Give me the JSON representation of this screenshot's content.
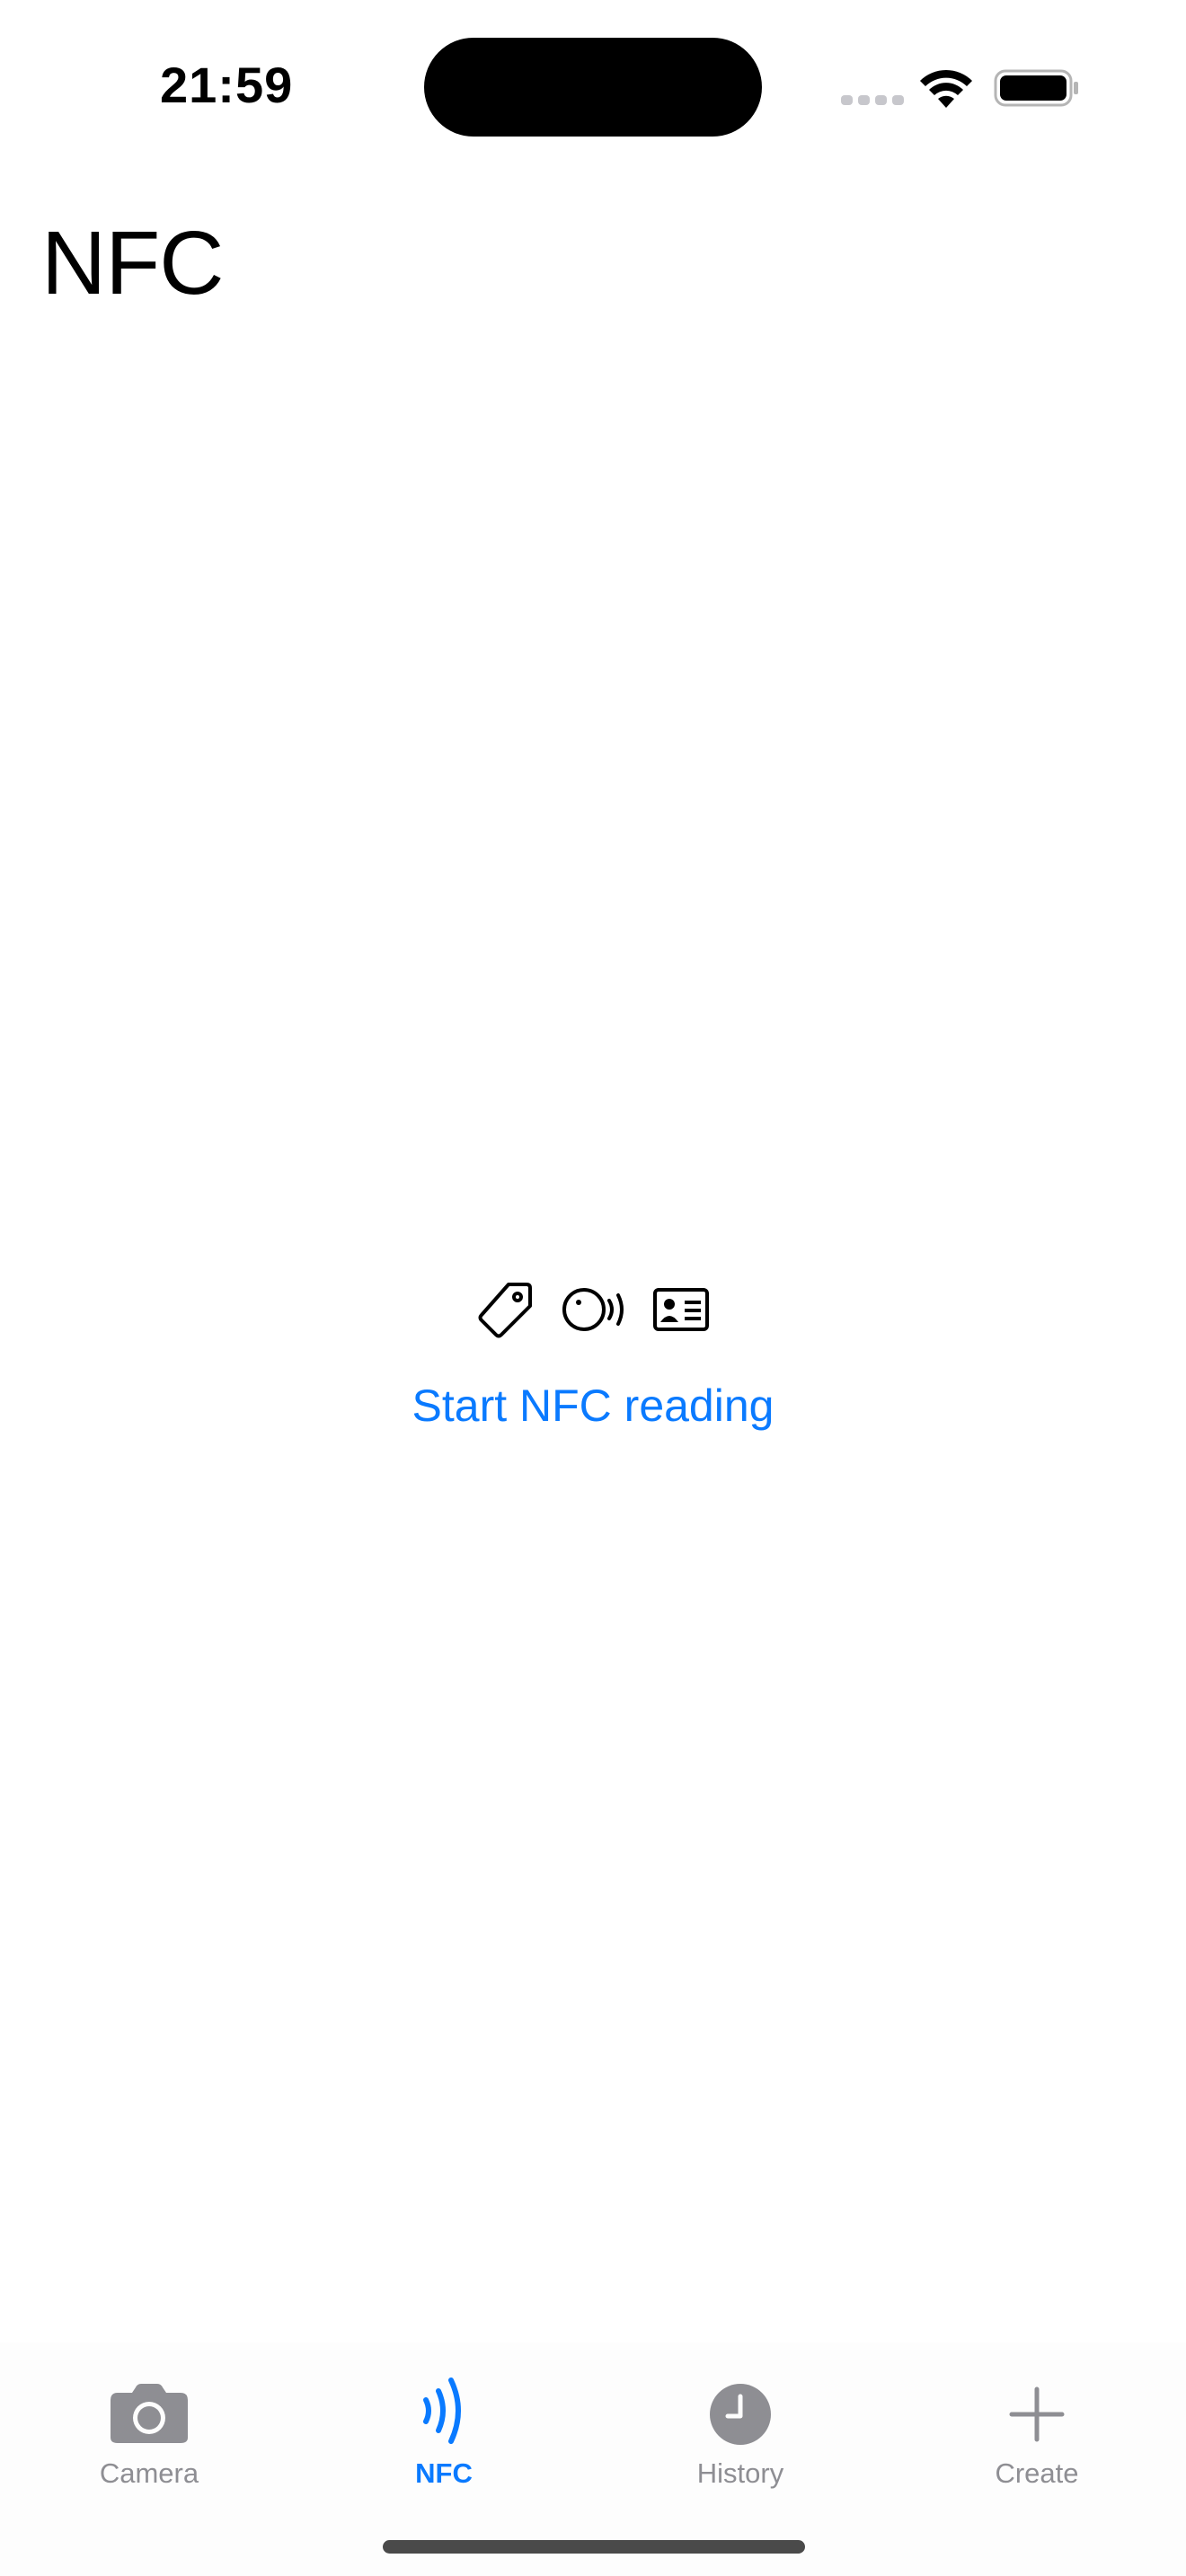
{
  "status_bar": {
    "time": "21:59"
  },
  "page": {
    "title": "NFC"
  },
  "main": {
    "icons": [
      "tag-icon",
      "nfc-reader-icon",
      "id-card-icon"
    ],
    "start_button_label": "Start NFC reading"
  },
  "tab_bar": {
    "tabs": [
      {
        "label": "Camera",
        "icon": "camera-icon",
        "active": false
      },
      {
        "label": "NFC",
        "icon": "nfc-icon",
        "active": true
      },
      {
        "label": "History",
        "icon": "clock-icon",
        "active": false
      },
      {
        "label": "Create",
        "icon": "plus-icon",
        "active": false
      }
    ]
  },
  "colors": {
    "accent": "#0a7aff",
    "inactive": "#8e8e93"
  }
}
